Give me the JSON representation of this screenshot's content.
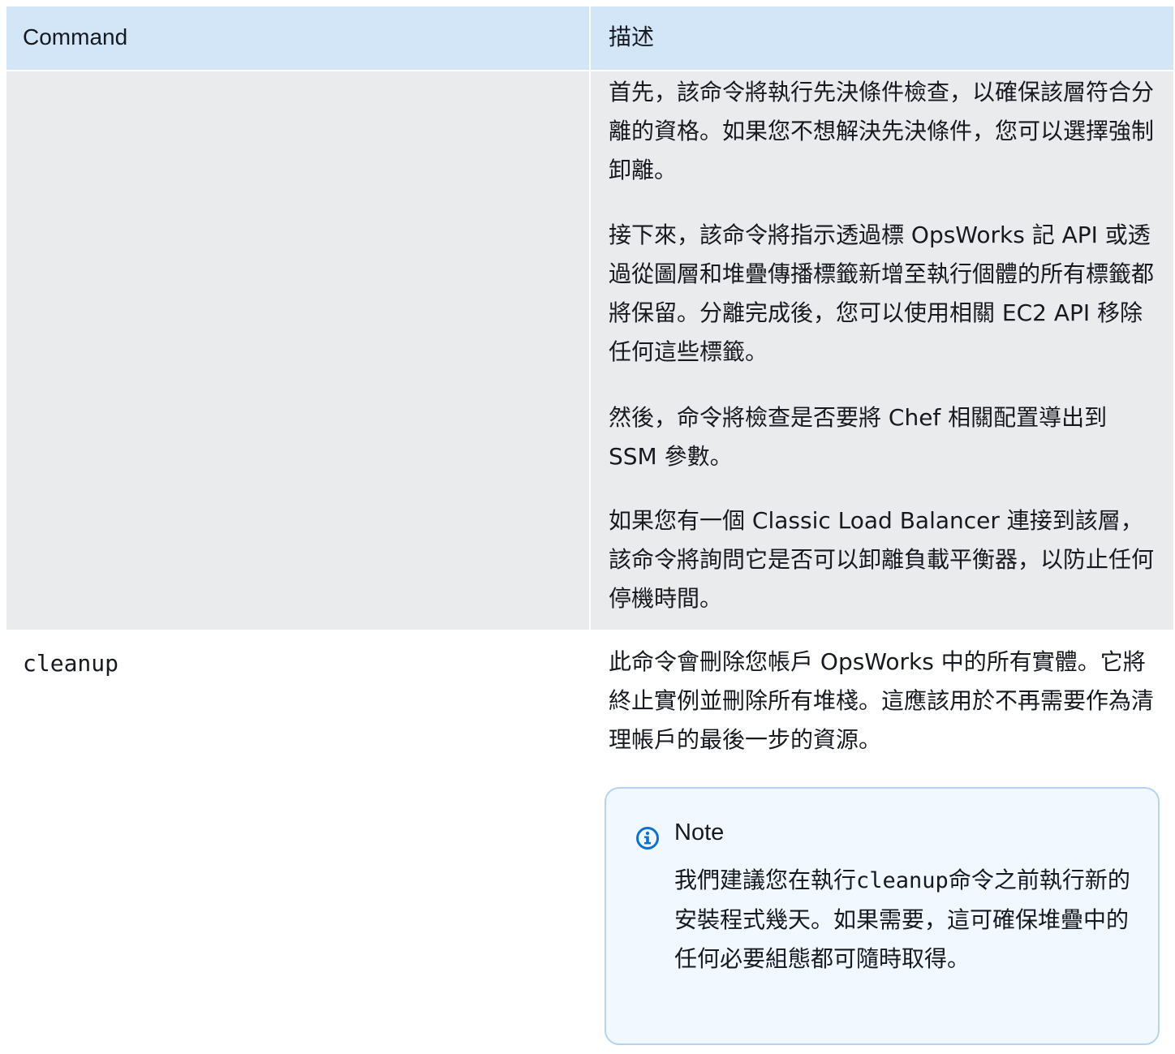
{
  "header": {
    "col1": "Command",
    "col2": "描述"
  },
  "row1": {
    "command": "",
    "paragraphs": {
      "p1": "首先，該命令將執行先決條件檢查，以確保該層符合分離的資格。如果您不想解決先決條件，您可以選擇強制卸離。",
      "p2": "接下來，該命令將指示透過標 OpsWorks 記 API 或透過從圖層和堆疊傳播標籤新增至執行個體的所有標籤都將保留。分離完成後，您可以使用相關 EC2 API 移除任何這些標籤。",
      "p3": "然後，命令將檢查是否要將 Chef 相關配置導出到 SSM 參數。",
      "p4": "如果您有一個 Classic Load Balancer 連接到該層，該命令將詢問它是否可以卸離負載平衡器，以防止任何停機時間。"
    }
  },
  "row2": {
    "command": "cleanup",
    "description": "此命令會刪除您帳戶 OpsWorks 中的所有實體。它將終止實例並刪除所有堆棧。這應該用於不再需要作為清理帳戶的最後一步的資源。",
    "note": {
      "icon": "info-circle-icon",
      "title": "Note",
      "body_before": "我們建議您在執行",
      "body_code": "cleanup",
      "body_after": "命令之前執行新的安裝程式幾天。如果需要，這可確保堆疊中的任何必要組態都可隨時取得。"
    }
  },
  "colors": {
    "header_bg": "#d3e6f8",
    "row_shaded_bg": "#eaebec",
    "note_border": "#b5d3ef",
    "note_bg": "#f1f8ff",
    "note_icon": "#0972d3",
    "text": "#16191f"
  }
}
